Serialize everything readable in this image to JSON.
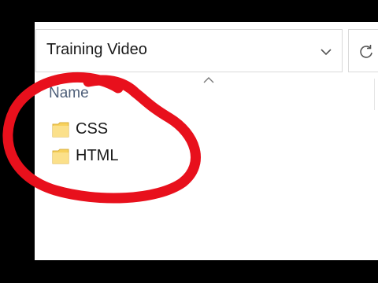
{
  "address_bar": {
    "path": "Training Video"
  },
  "column_header": {
    "name_label": "Name"
  },
  "files": [
    {
      "name": "CSS",
      "type": "folder"
    },
    {
      "name": "HTML",
      "type": "folder"
    }
  ],
  "colors": {
    "background": "#000000",
    "window": "#ffffff",
    "folder": "#f7d15c",
    "annotation": "#e8101c",
    "header_text": "#4e5f79"
  },
  "icons": [
    "chevron-down-icon",
    "refresh-icon",
    "sort-ascending-icon",
    "folder-icon"
  ]
}
